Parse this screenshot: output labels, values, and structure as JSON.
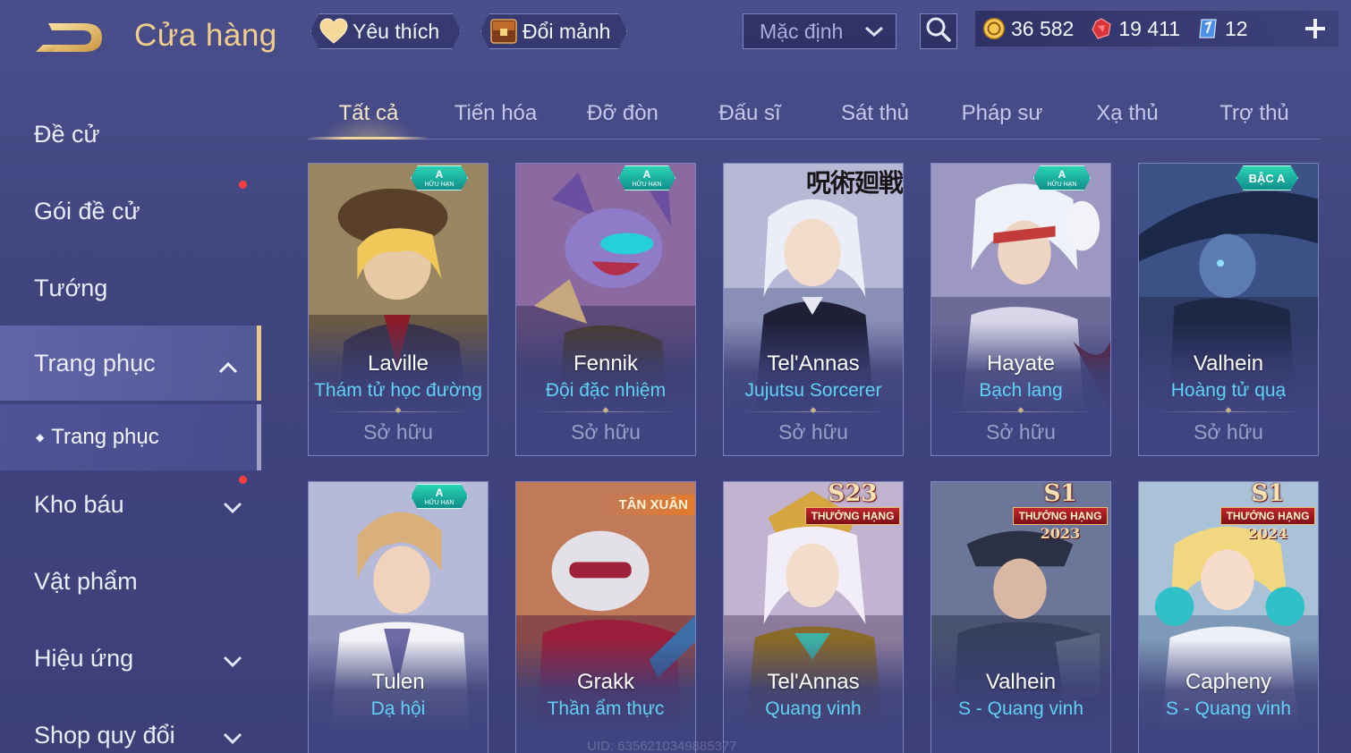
{
  "header": {
    "title": "Cửa hàng",
    "favorites_label": "Yêu thích",
    "exchange_label": "Đổi mảnh",
    "sort_value": "Mặc định",
    "currencies": [
      {
        "icon": "gold-coin-icon",
        "value": "36 582"
      },
      {
        "icon": "red-voucher-icon",
        "value": "19 411"
      },
      {
        "icon": "blue-ticket-icon",
        "value": "12"
      }
    ]
  },
  "sidebar": {
    "items": [
      {
        "label": "Đề cử"
      },
      {
        "label": "Gói đề cử"
      },
      {
        "label": "Tướng"
      },
      {
        "label": "Trang phục"
      },
      {
        "label": "Trang phục"
      },
      {
        "label": "Kho báu"
      },
      {
        "label": "Vật phẩm"
      },
      {
        "label": "Hiệu ứng"
      },
      {
        "label": "Shop quy đổi"
      }
    ]
  },
  "tabs": [
    {
      "label": "Tất cả"
    },
    {
      "label": "Tiến hóa"
    },
    {
      "label": "Đỡ đòn"
    },
    {
      "label": "Đấu sĩ"
    },
    {
      "label": "Sát thủ"
    },
    {
      "label": "Pháp sư"
    },
    {
      "label": "Xạ thủ"
    },
    {
      "label": "Trợ thủ"
    }
  ],
  "cards": [
    {
      "hero": "Laville",
      "skin": "Thám tử học đường",
      "status": "Sở hữu",
      "badge_grade": "A",
      "badge_sub": "HỮU HẠN"
    },
    {
      "hero": "Fennik",
      "skin": "Đội đặc nhiệm",
      "status": "Sở hữu",
      "badge_grade": "A",
      "badge_sub": "HỮU HẠN"
    },
    {
      "hero": "Tel'Annas",
      "skin": "Jujutsu Sorcerer",
      "status": "Sở hữu",
      "badge_text": "呪術廻戦"
    },
    {
      "hero": "Hayate",
      "skin": "Bạch lang",
      "status": "Sở hữu",
      "badge_grade": "A",
      "badge_sub": "HỮU HẠN"
    },
    {
      "hero": "Valhein",
      "skin": "Hoàng tử quạ",
      "status": "Sở hữu",
      "badge_text": "BẬC A"
    },
    {
      "hero": "Tulen",
      "skin": "Dạ hội",
      "badge_grade": "A",
      "badge_sub": "HỮU HẠN"
    },
    {
      "hero": "Grakk",
      "skin": "Thần ẩm thực",
      "badge_text": "TÂN XUÂN"
    },
    {
      "hero": "Tel'Annas",
      "skin": "Quang vinh",
      "badge_season": "S23",
      "badge_banner": "THƯỞNG HẠNG"
    },
    {
      "hero": "Valhein",
      "skin": "S - Quang vinh",
      "badge_season": "S1",
      "badge_banner": "THƯỞNG HẠNG",
      "badge_year": "2023"
    },
    {
      "hero": "Capheny",
      "skin": "S - Quang vinh",
      "badge_season": "S1",
      "badge_banner": "THƯỞNG HẠNG",
      "badge_year": "2024"
    }
  ],
  "footer": {
    "uid": "UID: 6356210349885377"
  },
  "colors": {
    "accent_gold": "#f0cf8c",
    "skin_name": "#5fd1f5",
    "notify_dot": "#ff3f3f",
    "background": "#44488a"
  }
}
